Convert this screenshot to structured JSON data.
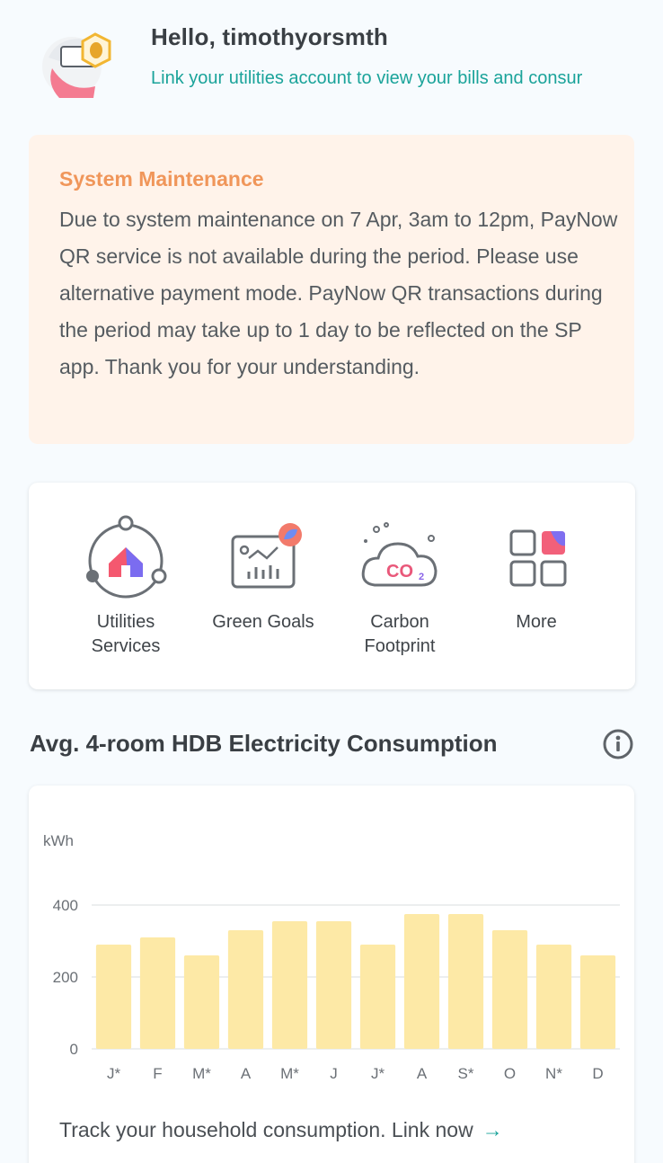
{
  "header": {
    "greeting": "Hello, timothyorsmth",
    "link_prompt": "Link your utilities account to view your bills and consur"
  },
  "notice": {
    "title": "System Maintenance",
    "body": "Due to system maintenance on 7 Apr, 3am to 12pm, PayNow QR service is not available during the period. Please use alternative payment mode. PayNow QR transactions during the period may take up to 1 day to be reflected on the SP app. Thank you for your understanding."
  },
  "services": [
    {
      "label_line1": "Utilities",
      "label_line2": "Services",
      "icon": "home-utilities-icon"
    },
    {
      "label_line1": "Green Goals",
      "label_line2": "",
      "icon": "green-goals-chart-icon"
    },
    {
      "label_line1": "Carbon",
      "label_line2": "Footprint",
      "icon": "co2-cloud-icon"
    },
    {
      "label_line1": "More",
      "label_line2": "",
      "icon": "grid-more-icon"
    }
  ],
  "consumption": {
    "title": "Avg. 4-room HDB Electricity Consumption",
    "cta_text": "Track your household consumption. Link now",
    "cta_arrow": "→"
  },
  "colors": {
    "accent": "#1aa39a",
    "notice_bg": "#fff3ea",
    "notice_title": "#f0965a",
    "bar": "#fde9a6"
  },
  "chart_data": {
    "type": "bar",
    "ylabel": "kWh",
    "yticks": [
      "0",
      "200",
      "400"
    ],
    "ylim": [
      0,
      400
    ],
    "grid": true,
    "categories": [
      "J*",
      "F",
      "M*",
      "A",
      "M*",
      "J",
      "J*",
      "A",
      "S*",
      "O",
      "N*",
      "D"
    ],
    "values": [
      290,
      310,
      260,
      330,
      355,
      355,
      290,
      375,
      375,
      330,
      290,
      260
    ]
  }
}
